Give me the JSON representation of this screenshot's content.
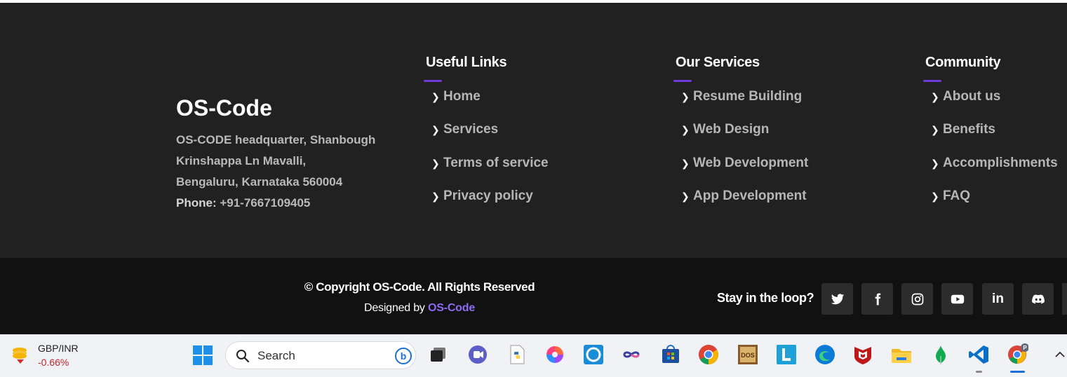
{
  "footer": {
    "brand": "OS-Code",
    "address_lines": [
      "OS-CODE headquarter, Shanbough",
      "Krinshappa Ln Mavalli,",
      "Bengaluru, Karnataka 560004"
    ],
    "phone_label": "Phone:",
    "phone_number": "+91-7667109405",
    "columns": [
      {
        "title": "Useful Links",
        "items": [
          "Home",
          "Services",
          "Terms of service",
          "Privacy policy"
        ]
      },
      {
        "title": "Our Services",
        "items": [
          "Resume Building",
          "Web Design",
          "Web Development",
          "App Development"
        ]
      },
      {
        "title": "Community",
        "items": [
          "About us",
          "Benefits",
          "Accomplishments",
          "FAQ"
        ]
      }
    ],
    "copyright": "© Copyright OS-Code. All Rights Reserved",
    "designed_by_prefix": "Designed by",
    "designed_by_link": "OS-Code",
    "stay_label": "Stay in the loop?",
    "social": [
      "twitter-icon",
      "facebook-icon",
      "instagram-icon",
      "youtube-icon",
      "linkedin-icon",
      "discord-icon"
    ]
  },
  "taskbar": {
    "ticker_name": "GBP/INR",
    "ticker_change": "-0.66%",
    "search_label": "Search",
    "apps": [
      "task-view-icon",
      "teams-chat-icon",
      "python-file-icon",
      "app-swirl-icon",
      "alexa-icon",
      "infinity-app-icon",
      "microsoft-store-icon",
      "chrome-icon",
      "dosbox-icon",
      "l-app-icon",
      "edge-icon",
      "mcafee-icon",
      "file-explorer-icon",
      "mongodb-icon",
      "vscode-icon",
      "chrome-profile-icon"
    ],
    "profile_badge": "P"
  },
  "colors": {
    "footer_top_bg": "#212121",
    "footer_bottom_bg": "#111111",
    "accent": "#6c3bd8",
    "link_purple": "#8f6af2",
    "ticker_negative": "#c4262e"
  }
}
